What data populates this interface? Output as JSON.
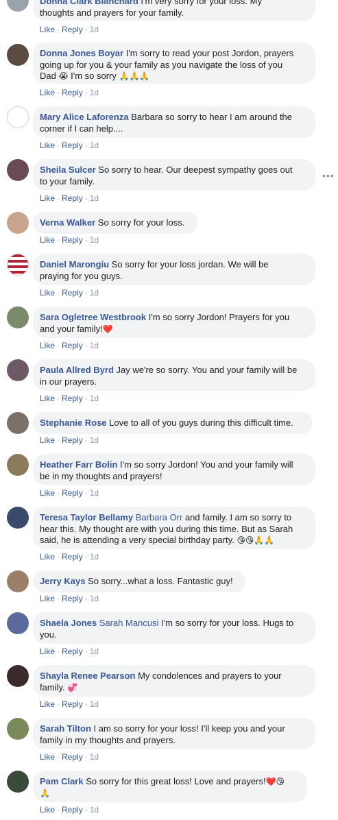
{
  "actions": {
    "like": "Like",
    "reply": "Reply"
  },
  "more_icon": "more-options-icon",
  "comments": [
    {
      "author": "Donna Clark Blanchard",
      "text": [
        " I'm very sorry for your loss. My",
        "thoughts and prayers for your family."
      ],
      "time": "1d"
    },
    {
      "author": "Donna Jones Boyar",
      "text": [
        " I'm sorry to read your post Jordon, prayers",
        "going up for you & your family as you navigate the loss of you",
        "Dad 😭 I'm so sorry 🙏🙏🙏"
      ],
      "time": "1d"
    },
    {
      "author": "Mary Alice Laforenza",
      "text": [
        " Barbara so sorry to hear I am around the",
        "corner if I can help...."
      ],
      "time": "1d"
    },
    {
      "author": "Sheila Sulcer",
      "text": [
        " So sorry to hear. Our deepest sympathy goes out",
        "to your family."
      ],
      "time": "1d"
    },
    {
      "author": "Verna Walker",
      "text": [
        " So sorry for your loss."
      ],
      "time": "1d"
    },
    {
      "author": "Daniel Marongiu",
      "text": [
        " So sorry for your loss jordan. We will be",
        "praying for you guys."
      ],
      "time": "1d"
    },
    {
      "author": "Sara Ogletree Westbrook",
      "text": [
        " I'm so sorry Jordon! Prayers for you",
        "and your family!❤️"
      ],
      "time": "1d"
    },
    {
      "author": "Paula Allred Byrd",
      "text": [
        " Jay we're so sorry. You and your family will be",
        "in our prayers."
      ],
      "time": "1d"
    },
    {
      "author": "Stephanie Rose",
      "text": [
        " Love to all of you guys during this difficult time."
      ],
      "time": "1d"
    },
    {
      "author": "Heather Farr Bolin",
      "text": [
        " I'm so sorry Jordon! You and your family will",
        "be in my thoughts and prayers!"
      ],
      "time": "1d"
    },
    {
      "author": "Teresa Taylor Bellamy",
      "mention": " Barbara Orr",
      "text": [
        " and family. I am so sorry to",
        "hear this. My thought are with you during this time. But as Sarah",
        "said, he is attending a very special birthday party. 😘😘🙏🙏"
      ],
      "time": "1d"
    },
    {
      "author": "Jerry Kays",
      "text": [
        " So sorry...what a loss. Fantastic guy!"
      ],
      "time": "1d"
    },
    {
      "author": "Shaela Jones",
      "mention": " Sarah Mancusi",
      "text": [
        " I'm so sorry for your loss. Hugs to",
        "you."
      ],
      "time": "1d"
    },
    {
      "author": "Shayla Renee Pearson",
      "text": [
        " My condolences and prayers to your",
        "family. 💞"
      ],
      "time": "1d"
    },
    {
      "author": "Sarah Tilton",
      "text": [
        " I am so sorry for your loss! I'll keep you and your",
        "family in my thoughts and prayers."
      ],
      "time": "1d"
    },
    {
      "author": "Pam Clark",
      "text": [
        " So sorry for this great loss! Love and prayers!❤️😘",
        "🙏"
      ],
      "time": "1d"
    }
  ]
}
